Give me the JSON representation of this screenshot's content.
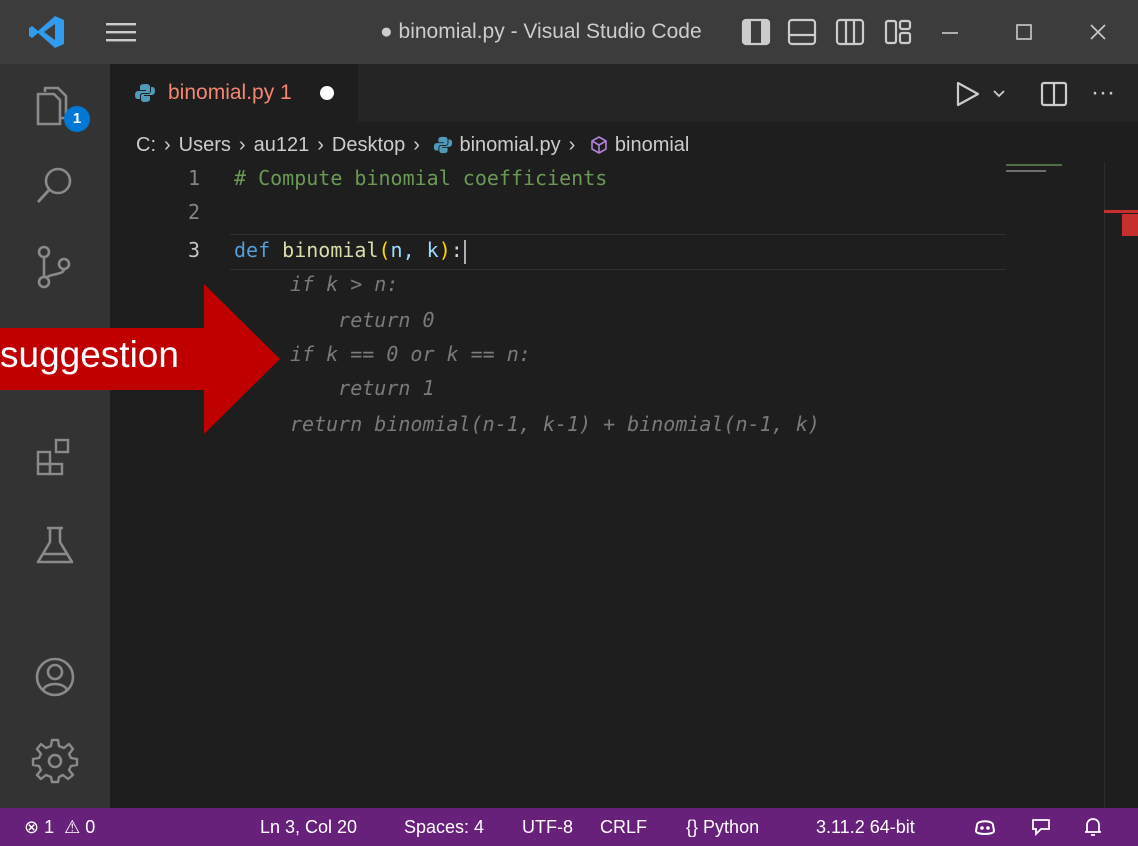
{
  "window": {
    "title": "● binomial.py - Visual Studio Code"
  },
  "activity_bar": {
    "explorer_badge": "1"
  },
  "tab": {
    "label": "binomial.py 1"
  },
  "breadcrumb": {
    "items": [
      "C:",
      "Users",
      "au121",
      "Desktop",
      "binomial.py",
      "binomial"
    ]
  },
  "editor": {
    "lines": [
      {
        "number": "1",
        "text": "# Compute binomial coefficients"
      },
      {
        "number": "2",
        "text": ""
      },
      {
        "number": "3",
        "text": "def binomial(n, k):"
      }
    ],
    "suggestion_lines": [
      "if k > n:",
      "    return 0",
      "if k == 0 or k == n:",
      "    return 1",
      "return binomial(n-1, k-1) + binomial(n-1, k)"
    ]
  },
  "annotation": {
    "label": "suggestion",
    "color": "#c00000"
  },
  "status_bar": {
    "errors": "1",
    "warnings": "0",
    "cursor": "Ln 3, Col 20",
    "spaces": "Spaces: 4",
    "encoding": "UTF-8",
    "eol": "CRLF",
    "language": "Python",
    "interpreter": "3.11.2 64-bit"
  },
  "colors": {
    "title_bar": "#3c3c3c",
    "activity_bar": "#333333",
    "editor_bg": "#1e1e1e",
    "status_bar": "#68217a",
    "accent": "#0078d4"
  }
}
